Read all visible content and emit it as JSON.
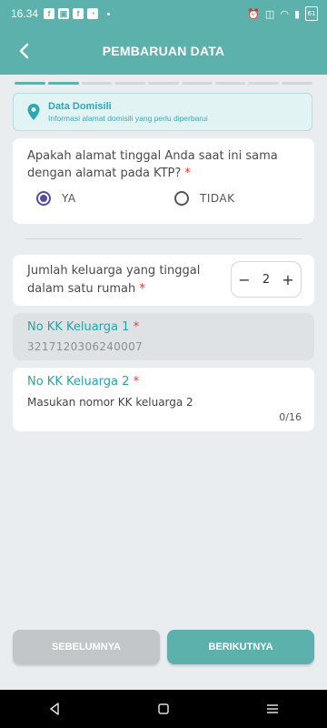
{
  "status": {
    "time": "16.34",
    "battery": "61"
  },
  "header": {
    "title": "PEMBARUAN DATA"
  },
  "stepper": {
    "total": 9,
    "completed": 2
  },
  "info": {
    "title": "Data Domisili",
    "subtitle": "Informasi alamat domisili yang perlu diperbarui"
  },
  "question1": {
    "text": "Apakah alamat tinggal Anda saat ini sama dengan alamat pada KTP?",
    "required_mark": "*",
    "option_yes": "YA",
    "option_no": "TIDAK",
    "selected": "YA"
  },
  "question2": {
    "text": "Jumlah keluarga yang tinggal dalam satu rumah",
    "required_mark": "*",
    "value": "2",
    "minus": "−",
    "plus": "+"
  },
  "kk1": {
    "label": "No KK Keluarga 1",
    "required_mark": "*",
    "value": "3217120306240007"
  },
  "kk2": {
    "label": "No KK Keluarga 2",
    "required_mark": "*",
    "placeholder": "Masukan nomor KK keluarga 2",
    "counter": "0/16"
  },
  "footer": {
    "prev_label": "SEBELUMNYA",
    "next_label": "BERIKUTNYA"
  },
  "colors": {
    "primary": "#5cb1ad",
    "radio_selected": "#5b4aa3",
    "required": "#e53935",
    "label_teal": "#2aa2a6"
  }
}
